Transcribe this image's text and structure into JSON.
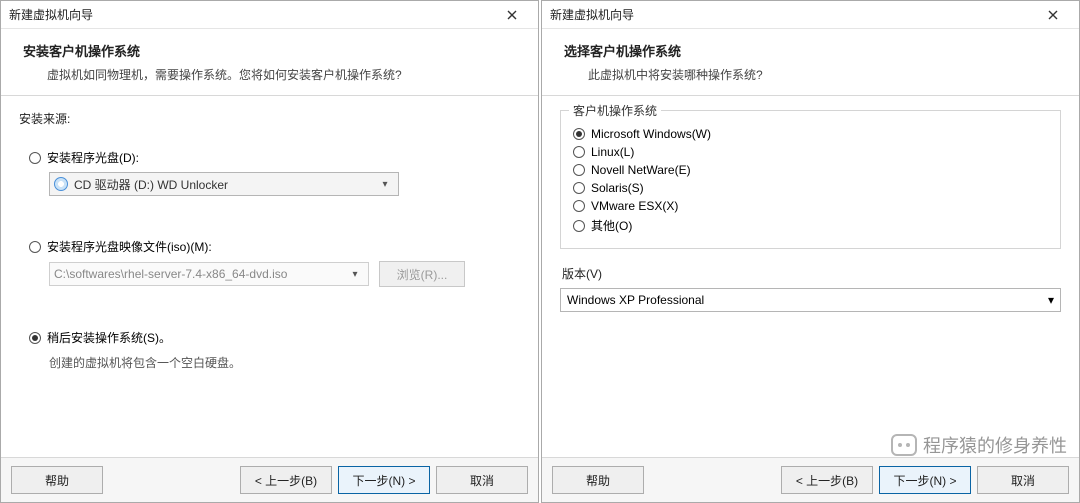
{
  "left": {
    "window_title": "新建虚拟机向导",
    "header_title": "安装客户机操作系统",
    "header_sub": "虚拟机如同物理机，需要操作系统。您将如何安装客户机操作系统?",
    "source_label": "安装来源:",
    "opt_disc_label": "安装程序光盘(D):",
    "disc_dropdown": "CD 驱动器 (D:) WD Unlocker",
    "opt_iso_label": "安装程序光盘映像文件(iso)(M):",
    "iso_path": "C:\\softwares\\rhel-server-7.4-x86_64-dvd.iso",
    "browse_label": "浏览(R)...",
    "opt_later_label": "稍后安装操作系统(S)。",
    "later_help": "创建的虚拟机将包含一个空白硬盘。",
    "buttons": {
      "help": "帮助",
      "back": "< 上一步(B)",
      "next": "下一步(N) >",
      "cancel": "取消"
    }
  },
  "right": {
    "window_title": "新建虚拟机向导",
    "header_title": "选择客户机操作系统",
    "header_sub": "此虚拟机中将安装哪种操作系统?",
    "os_group_title": "客户机操作系统",
    "os_options": [
      "Microsoft Windows(W)",
      "Linux(L)",
      "Novell NetWare(E)",
      "Solaris(S)",
      "VMware ESX(X)",
      "其他(O)"
    ],
    "version_label": "版本(V)",
    "version_value": "Windows XP Professional",
    "watermark": "程序猿的修身养性",
    "buttons": {
      "help": "帮助",
      "back": "< 上一步(B)",
      "next": "下一步(N) >",
      "cancel": "取消"
    }
  }
}
